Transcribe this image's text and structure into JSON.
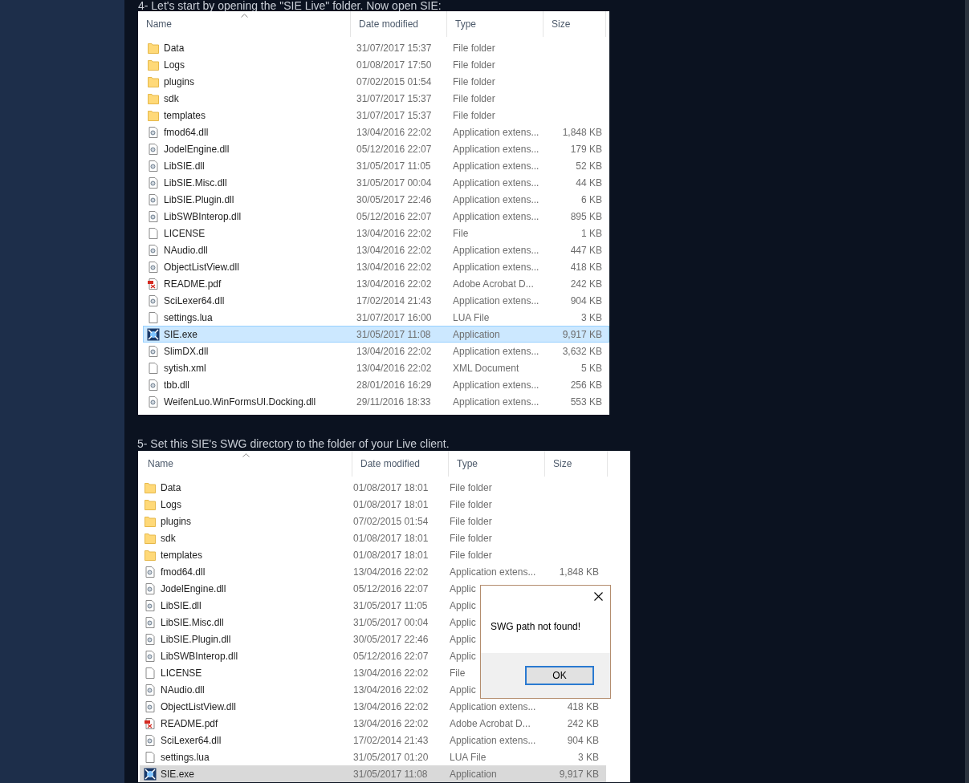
{
  "listings": [
    {
      "heading": "4- Let's start by opening the \"SIE Live\" folder. Now open SIE:",
      "focused": true,
      "columns": [
        {
          "label": "Name",
          "sorted": true
        },
        {
          "label": "Date modified",
          "sorted": false
        },
        {
          "label": "Type",
          "sorted": false
        },
        {
          "label": "Size",
          "sorted": false
        }
      ],
      "rows": [
        {
          "kind": "folder",
          "name": "Data",
          "date": "31/07/2017 15:37",
          "type": "File folder",
          "selected": false
        },
        {
          "kind": "folder",
          "name": "Logs",
          "date": "01/08/2017 17:50",
          "type": "File folder",
          "selected": false
        },
        {
          "kind": "folder",
          "name": "plugins",
          "date": "07/02/2015 01:54",
          "type": "File folder",
          "selected": false
        },
        {
          "kind": "folder",
          "name": "sdk",
          "date": "31/07/2017 15:37",
          "type": "File folder",
          "selected": false
        },
        {
          "kind": "folder",
          "name": "templates",
          "date": "31/07/2017 15:37",
          "type": "File folder",
          "selected": false
        },
        {
          "kind": "dll",
          "name": "fmod64.dll",
          "date": "13/04/2016 22:02",
          "type": "Application extens...",
          "size": "1,848 KB",
          "selected": false
        },
        {
          "kind": "dll",
          "name": "JodelEngine.dll",
          "date": "05/12/2016 22:07",
          "type": "Application extens...",
          "size": "179 KB",
          "selected": false
        },
        {
          "kind": "dll",
          "name": "LibSIE.dll",
          "date": "31/05/2017 11:05",
          "type": "Application extens...",
          "size": "52 KB",
          "selected": false
        },
        {
          "kind": "dll",
          "name": "LibSIE.Misc.dll",
          "date": "31/05/2017 00:04",
          "type": "Application extens...",
          "size": "44 KB",
          "selected": false
        },
        {
          "kind": "dll",
          "name": "LibSIE.Plugin.dll",
          "date": "30/05/2017 22:46",
          "type": "Application extens...",
          "size": "6 KB",
          "selected": false
        },
        {
          "kind": "dll",
          "name": "LibSWBInterop.dll",
          "date": "05/12/2016 22:07",
          "type": "Application extens...",
          "size": "895 KB",
          "selected": false
        },
        {
          "kind": "file",
          "name": "LICENSE",
          "date": "13/04/2016 22:02",
          "type": "File",
          "size": "1 KB",
          "selected": false
        },
        {
          "kind": "dll",
          "name": "NAudio.dll",
          "date": "13/04/2016 22:02",
          "type": "Application extens...",
          "size": "447 KB",
          "selected": false
        },
        {
          "kind": "dll",
          "name": "ObjectListView.dll",
          "date": "13/04/2016 22:02",
          "type": "Application extens...",
          "size": "418 KB",
          "selected": false
        },
        {
          "kind": "pdf",
          "name": "README.pdf",
          "date": "13/04/2016 22:02",
          "type": "Adobe Acrobat D...",
          "size": "242 KB",
          "selected": false
        },
        {
          "kind": "dll",
          "name": "SciLexer64.dll",
          "date": "17/02/2014 21:43",
          "type": "Application extens...",
          "size": "904 KB",
          "selected": false
        },
        {
          "kind": "file",
          "name": "settings.lua",
          "date": "31/07/2017 16:00",
          "type": "LUA File",
          "size": "3 KB",
          "selected": false
        },
        {
          "kind": "exe",
          "name": "SIE.exe",
          "date": "31/05/2017 11:08",
          "type": "Application",
          "size": "9,917 KB",
          "selected": true
        },
        {
          "kind": "dll",
          "name": "SlimDX.dll",
          "date": "13/04/2016 22:02",
          "type": "Application extens...",
          "size": "3,632 KB",
          "selected": false
        },
        {
          "kind": "file",
          "name": "sytish.xml",
          "date": "13/04/2016 22:02",
          "type": "XML Document",
          "size": "5 KB",
          "selected": false
        },
        {
          "kind": "dll",
          "name": "tbb.dll",
          "date": "28/01/2016 16:29",
          "type": "Application extens...",
          "size": "256 KB",
          "selected": false
        },
        {
          "kind": "dll",
          "name": "WeifenLuo.WinFormsUI.Docking.dll",
          "date": "29/11/2016 18:33",
          "type": "Application extens...",
          "size": "553 KB",
          "selected": false
        }
      ]
    },
    {
      "heading": "5- Set this SIE's SWG directory to the folder of your Live client.",
      "focused": false,
      "columns": [
        {
          "label": "Name",
          "sorted": true
        },
        {
          "label": "Date modified",
          "sorted": false
        },
        {
          "label": "Type",
          "sorted": false
        },
        {
          "label": "Size",
          "sorted": false
        }
      ],
      "rows": [
        {
          "kind": "folder",
          "name": "Data",
          "date": "01/08/2017 18:01",
          "type": "File folder",
          "selected": false
        },
        {
          "kind": "folder",
          "name": "Logs",
          "date": "01/08/2017 18:01",
          "type": "File folder",
          "selected": false
        },
        {
          "kind": "folder",
          "name": "plugins",
          "date": "07/02/2015 01:54",
          "type": "File folder",
          "selected": false
        },
        {
          "kind": "folder",
          "name": "sdk",
          "date": "01/08/2017 18:01",
          "type": "File folder",
          "selected": false
        },
        {
          "kind": "folder",
          "name": "templates",
          "date": "01/08/2017 18:01",
          "type": "File folder",
          "selected": false
        },
        {
          "kind": "dll",
          "name": "fmod64.dll",
          "date": "13/04/2016 22:02",
          "type": "Application extens...",
          "size": "1,848 KB",
          "selected": false
        },
        {
          "kind": "dll",
          "name": "JodelEngine.dll",
          "date": "05/12/2016 22:07",
          "type": "Applic",
          "selected": false
        },
        {
          "kind": "dll",
          "name": "LibSIE.dll",
          "date": "31/05/2017 11:05",
          "type": "Applic",
          "selected": false
        },
        {
          "kind": "dll",
          "name": "LibSIE.Misc.dll",
          "date": "31/05/2017 00:04",
          "type": "Applic",
          "selected": false
        },
        {
          "kind": "dll",
          "name": "LibSIE.Plugin.dll",
          "date": "30/05/2017 22:46",
          "type": "Applic",
          "selected": false
        },
        {
          "kind": "dll",
          "name": "LibSWBInterop.dll",
          "date": "05/12/2016 22:07",
          "type": "Applic",
          "selected": false
        },
        {
          "kind": "file",
          "name": "LICENSE",
          "date": "13/04/2016 22:02",
          "type": "File",
          "selected": false
        },
        {
          "kind": "dll",
          "name": "NAudio.dll",
          "date": "13/04/2016 22:02",
          "type": "Applic",
          "selected": false
        },
        {
          "kind": "dll",
          "name": "ObjectListView.dll",
          "date": "13/04/2016 22:02",
          "type": "Application extens...",
          "size": "418 KB",
          "selected": false
        },
        {
          "kind": "pdf",
          "name": "README.pdf",
          "date": "13/04/2016 22:02",
          "type": "Adobe Acrobat D...",
          "size": "242 KB",
          "selected": false
        },
        {
          "kind": "dll",
          "name": "SciLexer64.dll",
          "date": "17/02/2014 21:43",
          "type": "Application extens...",
          "size": "904 KB",
          "selected": false
        },
        {
          "kind": "file",
          "name": "settings.lua",
          "date": "31/05/2017 01:20",
          "type": "LUA File",
          "size": "3 KB",
          "selected": false
        },
        {
          "kind": "exe",
          "name": "SIE.exe",
          "date": "31/05/2017 11:08",
          "type": "Application",
          "size": "9,917 KB",
          "selected": true
        }
      ],
      "dialog": {
        "message": "SWG path not found!",
        "button": "OK"
      }
    }
  ]
}
